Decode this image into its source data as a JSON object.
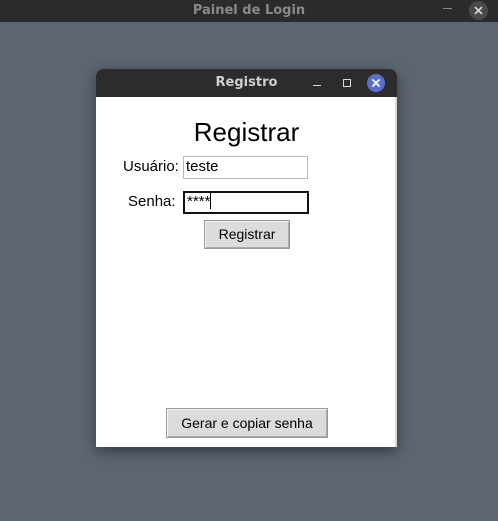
{
  "outer_window": {
    "title": "Painel de Login"
  },
  "dialog": {
    "title": "Registro",
    "heading": "Registrar",
    "username_label": "Usuário:",
    "username_value": "teste",
    "password_label": "Senha:",
    "password_value": "****",
    "register_button": "Registrar",
    "generate_button": "Gerar e copiar senha"
  },
  "icons": {
    "outer_minimize": "minimize-icon",
    "outer_close": "close-icon",
    "dialog_minimize": "minimize-icon",
    "dialog_maximize": "maximize-icon",
    "dialog_close": "close-icon"
  },
  "colors": {
    "desktop_background": "#5d6573",
    "titlebar": "#2c2c2c",
    "close_button_accent": "#5a6fc8",
    "button_face": "#dcdcdc"
  }
}
